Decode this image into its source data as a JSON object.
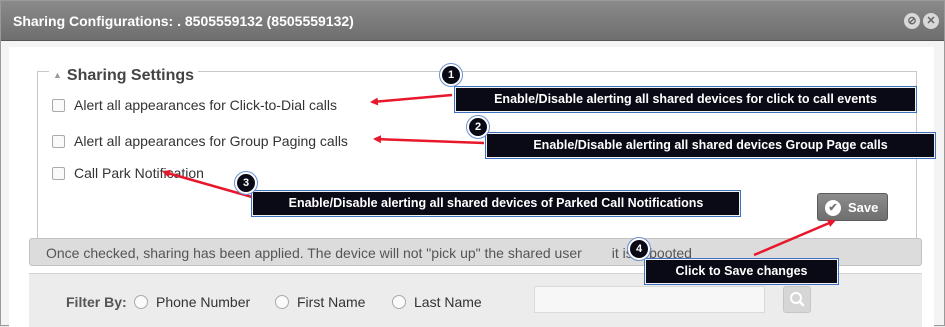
{
  "dialog": {
    "title": "Sharing Configurations: . 8505559132 (8505559132)",
    "icons": [
      "settings-icon",
      "close-icon"
    ]
  },
  "settings": {
    "legend": "Sharing Settings",
    "options": [
      {
        "label": "Alert all appearances for Click-to-Dial calls",
        "checked": false
      },
      {
        "label": "Alert all appearances for Group Paging calls",
        "checked": false
      },
      {
        "label": "Call Park Notification",
        "checked": false
      }
    ],
    "save_label": "Save"
  },
  "info_text": "Once checked, sharing has been applied. The device will not \"pick up\" the shared user",
  "info_text_tail": "it is rebooted",
  "filter": {
    "label": "Filter By:",
    "options": [
      "Phone Number",
      "First Name",
      "Last Name"
    ],
    "search_value": ""
  },
  "annotations": [
    {
      "number": "1",
      "text": "Enable/Disable alerting all shared devices for click to call events"
    },
    {
      "number": "2",
      "text": "Enable/Disable alerting all shared devices Group Page calls"
    },
    {
      "number": "3",
      "text": "Enable/Disable alerting all shared devices of Parked Call Notifications"
    },
    {
      "number": "4",
      "text": "Click to Save changes"
    }
  ],
  "colors": {
    "annotation_arrow": "#e8182c",
    "callout_background": "#0a0a16",
    "titlebar": "#7a7a7a"
  }
}
